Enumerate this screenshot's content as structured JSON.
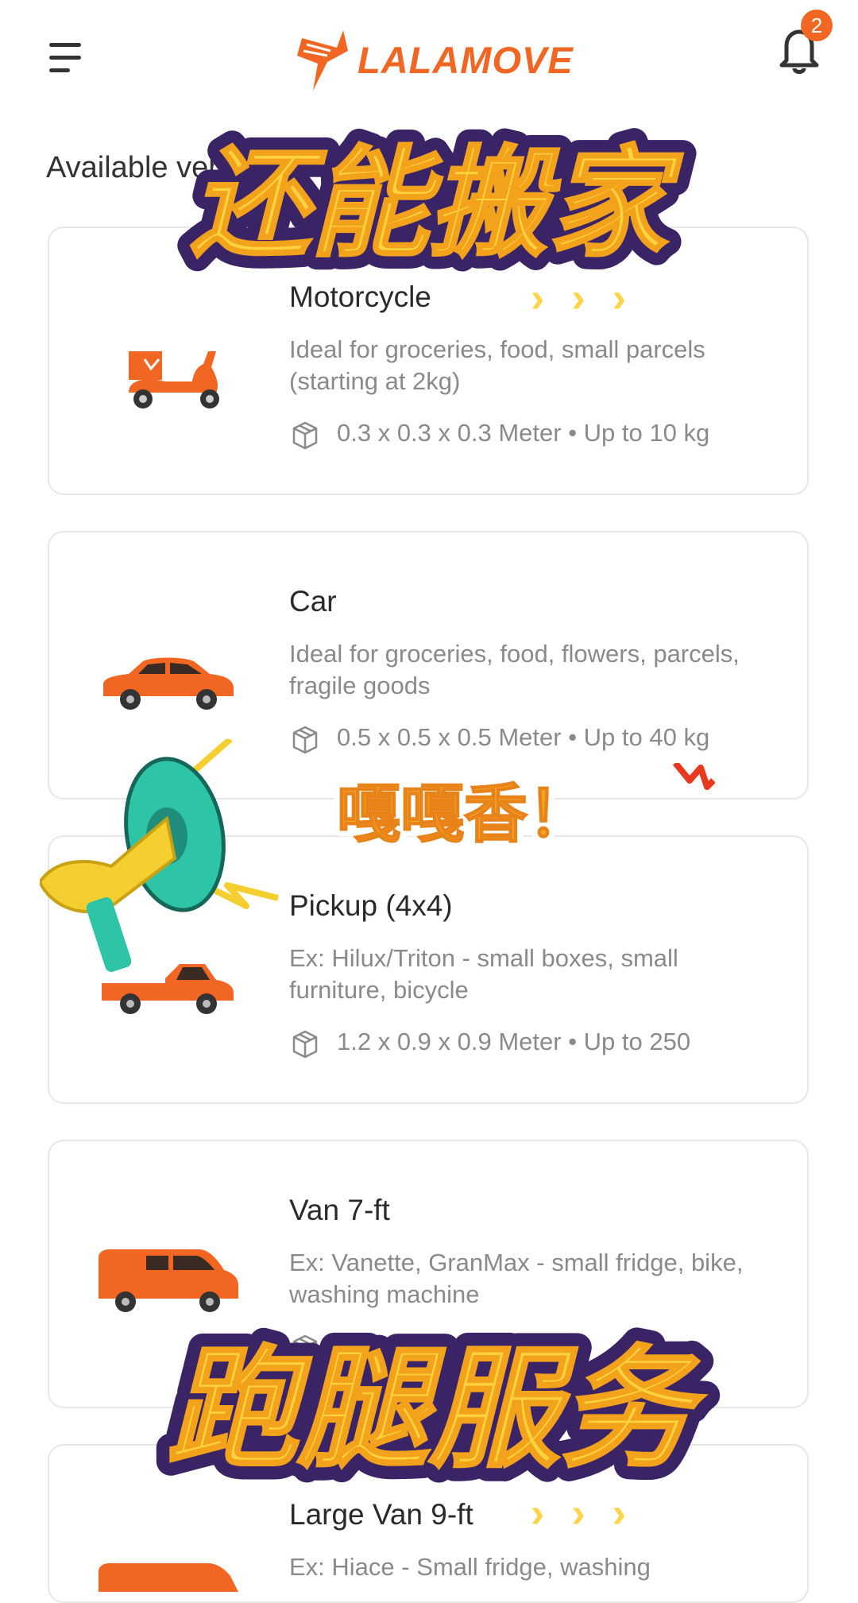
{
  "header": {
    "menu_icon": "hamburger-menu-icon",
    "logo_text": "LALAMOVE",
    "notification_icon": "bell-icon",
    "notification_count": "2"
  },
  "section_title": "Available vehicles",
  "vehicles": [
    {
      "name": "Motorcycle",
      "description": "Ideal for groceries, food, small parcels (starting at 2kg)",
      "spec": "0.3 x 0.3 x 0.3 Meter • Up to 10 kg",
      "icon": "motorcycle-icon"
    },
    {
      "name": "Car",
      "description": "Ideal for groceries, food, flowers, parcels, fragile goods",
      "spec": "0.5 x 0.5 x 0.5 Meter • Up to 40 kg",
      "icon": "car-icon"
    },
    {
      "name": "Pickup (4x4)",
      "description": "Ex: Hilux/Triton - small boxes, small furniture, bicycle",
      "spec": "1.2 x 0.9 x 0.9 Meter • Up to 250",
      "icon": "pickup-truck-icon"
    },
    {
      "name": "Van 7-ft",
      "description": "Ex: Vanette, GranMax - small fridge, bike, washing machine",
      "spec": "",
      "icon": "van-icon"
    },
    {
      "name": "Large Van 9-ft",
      "description": "Ex: Hiace - Small fridge, washing",
      "spec": "",
      "icon": "large-van-icon"
    }
  ],
  "overlays": {
    "top_caption": "还能搬家",
    "bottom_caption": "跑腿服务",
    "sticker_text": "嘎嘎香！",
    "arrows": "›››"
  },
  "colors": {
    "brand_orange": "#f16622",
    "caption_yellow": "#ffd23f",
    "caption_outline": "#3b2466",
    "card_border": "#e7e7e7",
    "muted_text": "#8a8a8a"
  }
}
